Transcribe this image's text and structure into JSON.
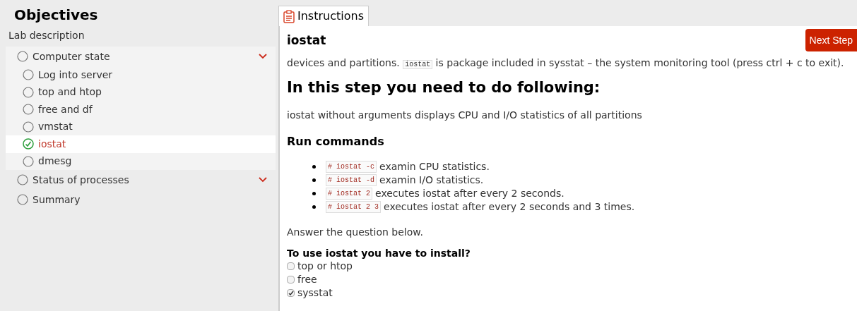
{
  "sidebar": {
    "title": "Objectives",
    "intro": "Lab description",
    "items": [
      {
        "kind": "group",
        "label": "Computer state",
        "done": false,
        "selected": false,
        "expanded": true,
        "children": [
          {
            "label": "Log into server",
            "done": false,
            "selected": false
          },
          {
            "label": "top and htop",
            "done": false,
            "selected": false
          },
          {
            "label": "free and df",
            "done": false,
            "selected": false
          },
          {
            "label": "vmstat",
            "done": false,
            "selected": false
          },
          {
            "label": "iostat",
            "done": true,
            "selected": true
          },
          {
            "label": "dmesg",
            "done": false,
            "selected": false
          }
        ]
      },
      {
        "kind": "group",
        "label": "Status of processes",
        "done": false,
        "selected": false
      },
      {
        "kind": "item",
        "label": "Summary",
        "done": false,
        "selected": false
      }
    ]
  },
  "tabs": [
    {
      "label": "Instructions",
      "selected": true
    }
  ],
  "step": {
    "title": "iostat",
    "next_button": "Next Step",
    "intro": [
      "devices and partitions. ",
      "iostat",
      " is package included in sysstat – the system monitoring tool (press ctrl + c to exit)."
    ],
    "heading": "In this step you need to do following:",
    "description": "iostat without arguments displays CPU and I/O statistics of all partitions",
    "subheading": "Run commands",
    "commands": [
      {
        "code": "# iostat -c",
        "text": "examin CPU statistics."
      },
      {
        "code": "# iostat -d",
        "text": "examin I/O statistics."
      },
      {
        "code": "# iostat 2",
        "text": "executes iostat after every 2 seconds."
      },
      {
        "code": "# iostat 2 3",
        "text": "executes iostat after every 2 seconds and 3 times."
      }
    ],
    "prompt": "Answer the question below.",
    "question": "To use iostat you have to install?",
    "options": [
      {
        "label": "top or htop",
        "checked": false
      },
      {
        "label": "free",
        "checked": false
      },
      {
        "label": "sysstat",
        "checked": true
      }
    ]
  }
}
